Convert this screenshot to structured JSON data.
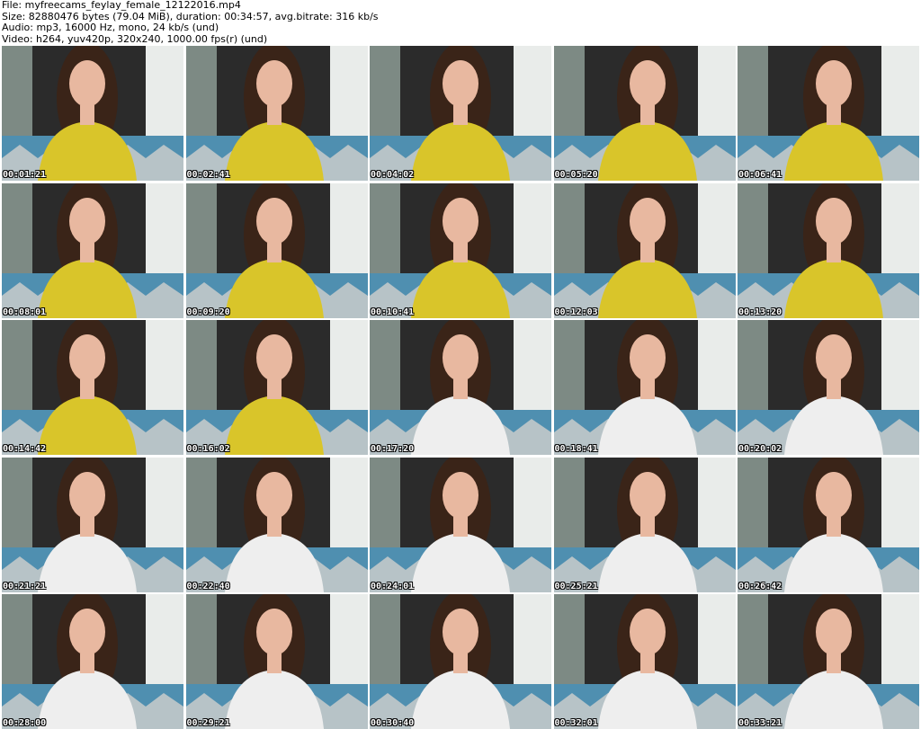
{
  "header": {
    "file_line": "File: myfreecams_feylay_female_12122016.mp4",
    "size_line": "Size: 82880476 bytes (79.04 MiB), duration: 00:34:57, avg.bitrate: 316 kb/s",
    "audio_line": "Audio: mp3, 16000 Hz, mono, 24 kb/s (und)",
    "video_line": "Video: h264, yuv420p, 320x240, 1000.00 fps(r) (und)"
  },
  "thumbnails": [
    {
      "timestamp": "00:01:21",
      "shirt": "yellow"
    },
    {
      "timestamp": "00:02:41",
      "shirt": "yellow"
    },
    {
      "timestamp": "00:04:02",
      "shirt": "yellow"
    },
    {
      "timestamp": "00:05:20",
      "shirt": "yellow"
    },
    {
      "timestamp": "00:06:41",
      "shirt": "yellow"
    },
    {
      "timestamp": "00:08:01",
      "shirt": "yellow"
    },
    {
      "timestamp": "00:09:20",
      "shirt": "yellow"
    },
    {
      "timestamp": "00:10:41",
      "shirt": "yellow"
    },
    {
      "timestamp": "00:12:03",
      "shirt": "yellow"
    },
    {
      "timestamp": "00:13:20",
      "shirt": "yellow"
    },
    {
      "timestamp": "00:14:42",
      "shirt": "yellow"
    },
    {
      "timestamp": "00:16:02",
      "shirt": "yellow"
    },
    {
      "timestamp": "00:17:20",
      "shirt": "white"
    },
    {
      "timestamp": "00:18:41",
      "shirt": "white"
    },
    {
      "timestamp": "00:20:02",
      "shirt": "white"
    },
    {
      "timestamp": "00:21:21",
      "shirt": "white"
    },
    {
      "timestamp": "00:22:40",
      "shirt": "white"
    },
    {
      "timestamp": "00:24:01",
      "shirt": "white"
    },
    {
      "timestamp": "00:25:21",
      "shirt": "white"
    },
    {
      "timestamp": "00:26:42",
      "shirt": "white"
    },
    {
      "timestamp": "00:28:00",
      "shirt": "white"
    },
    {
      "timestamp": "00:29:21",
      "shirt": "white"
    },
    {
      "timestamp": "00:30:40",
      "shirt": "white"
    },
    {
      "timestamp": "00:32:01",
      "shirt": "white"
    },
    {
      "timestamp": "00:33:21",
      "shirt": "white"
    }
  ],
  "colors": {
    "page_background": "#ffffff",
    "header_text": "#000000",
    "timestamp_text": "#ffffff",
    "wall": "#2b2b2b",
    "wall_light": "#e9ecea",
    "couch": "#4f8fb0",
    "yellow_shirt": "#d9c52a",
    "white_shirt": "#eeeeee",
    "hair": "#3a2418",
    "skin": "#e8b8a0"
  },
  "icons": {
    "thumbnail": "video-frame-thumbnail"
  }
}
